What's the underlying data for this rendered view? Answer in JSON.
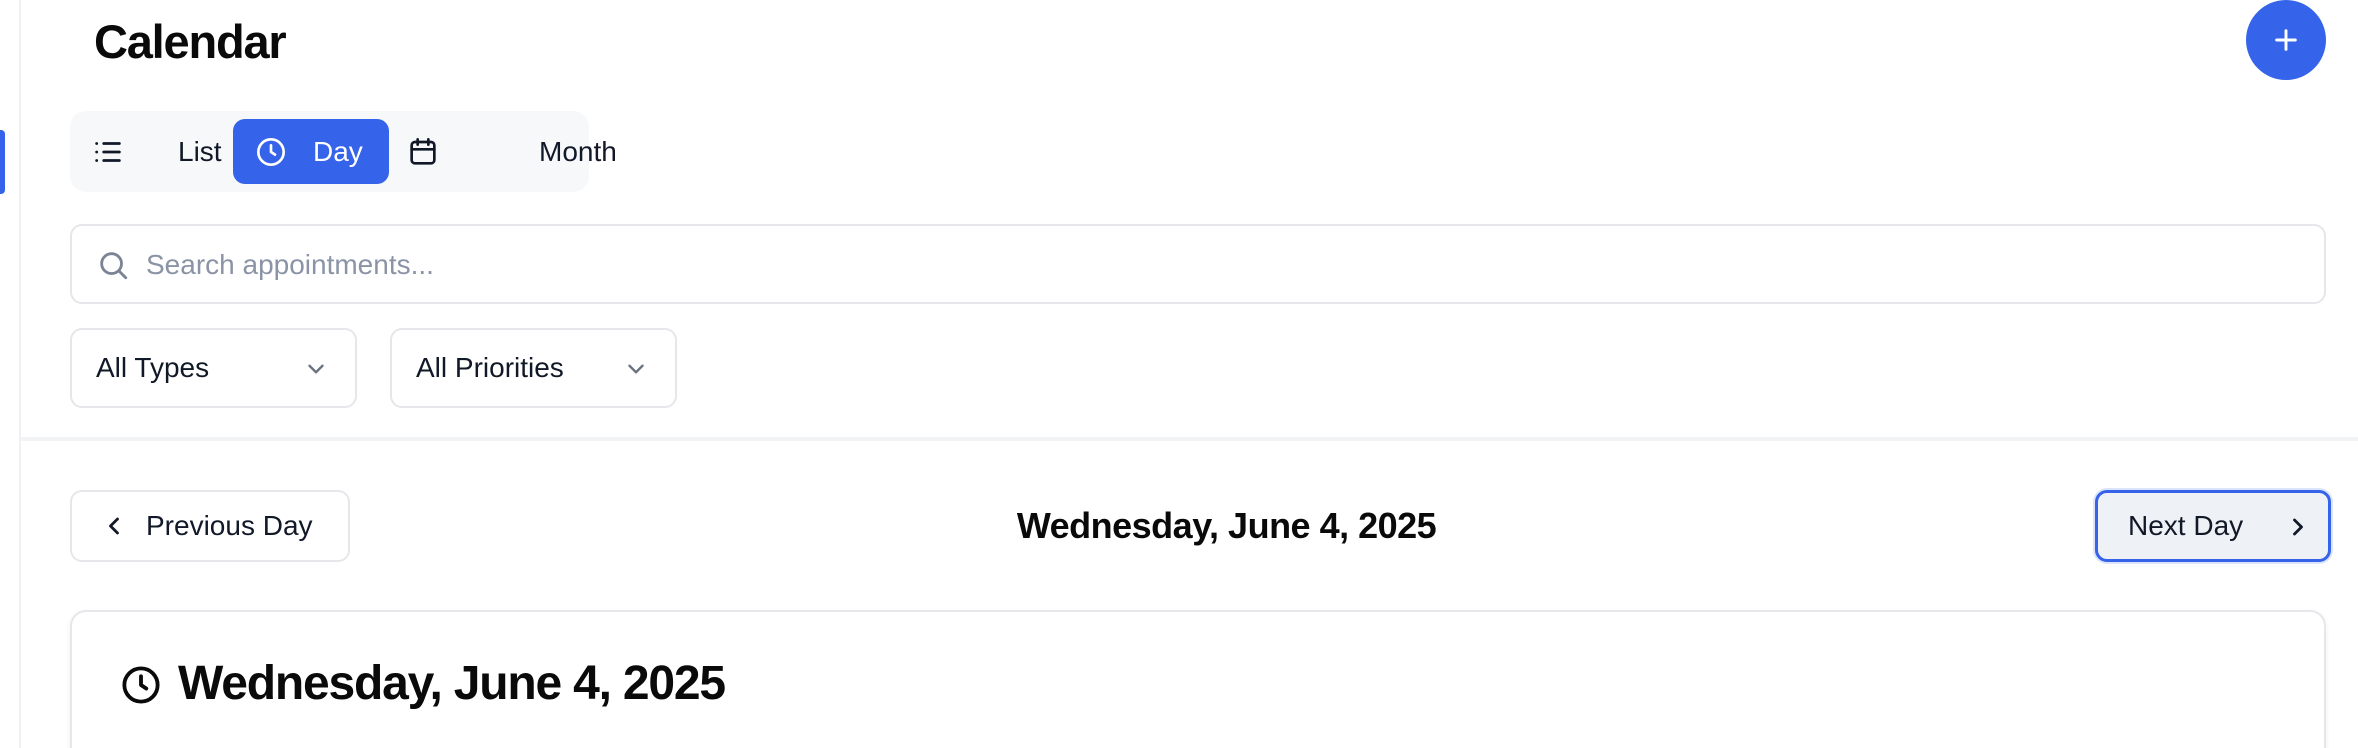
{
  "page": {
    "title": "Calendar",
    "add_button_icon": "plus-icon"
  },
  "view_switcher": {
    "active": "Day",
    "tabs": [
      {
        "label": "List",
        "icon": "list-icon"
      },
      {
        "label": "Day",
        "icon": "clock-icon"
      },
      {
        "label": "Month",
        "icon": "calendar-icon"
      }
    ]
  },
  "search": {
    "placeholder": "Search appointments...",
    "value": "",
    "icon": "search-icon"
  },
  "filters": {
    "type": {
      "selected": "All Types",
      "icon": "chevron-down-icon"
    },
    "priority": {
      "selected": "All Priorities",
      "icon": "chevron-down-icon"
    }
  },
  "day_nav": {
    "previous_label": "Previous Day",
    "next_label": "Next Day",
    "current_date": "Wednesday, June 4, 2025"
  },
  "day_card": {
    "title": "Wednesday, June 4, 2025",
    "icon": "clock-icon"
  },
  "colors": {
    "accent": "#3563e9",
    "border": "#e5e7eb",
    "placeholder": "#8a94a6",
    "text": "#0a0a0a"
  }
}
